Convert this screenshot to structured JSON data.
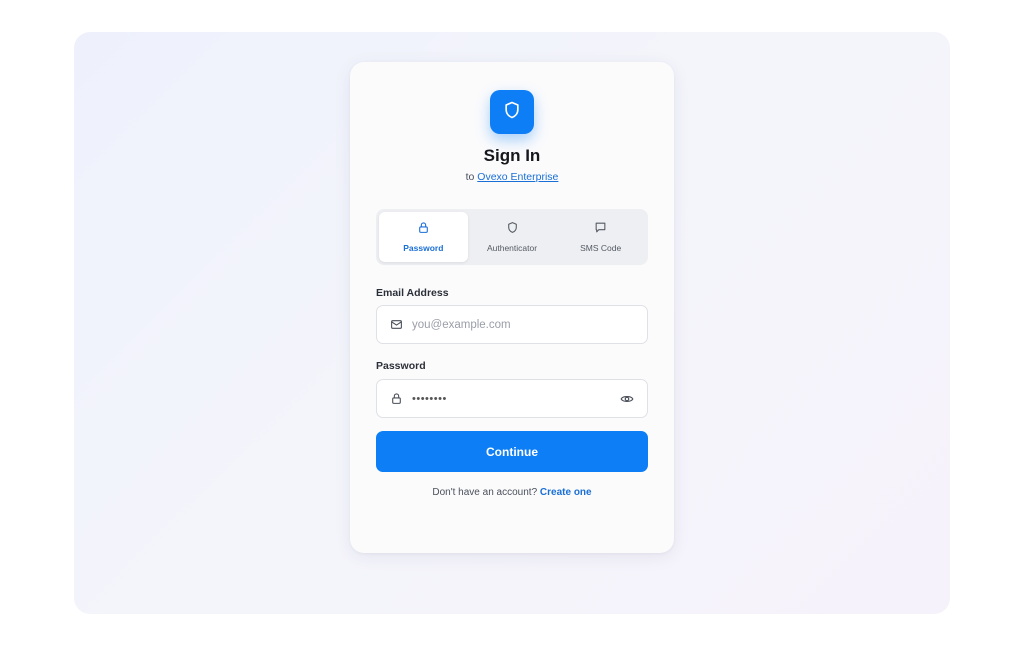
{
  "auth": {
    "title": "Sign In",
    "subtitle_prefix": "to",
    "org_name": "Ovexo Enterprise",
    "brand_color": "#0d7ef5",
    "logo_icon": "shield-icon"
  },
  "tabs": [
    {
      "label": "Password",
      "icon": "lock-icon",
      "active": true
    },
    {
      "label": "Authenticator",
      "icon": "shield-icon",
      "active": false
    },
    {
      "label": "SMS Code",
      "icon": "message-icon",
      "active": false
    }
  ],
  "email": {
    "label": "Email Address",
    "placeholder": "you@example.com",
    "value": "",
    "icon": "mail-icon"
  },
  "password": {
    "label": "Password",
    "value": "••••••••",
    "icon": "lock-icon",
    "toggle_icon": "eye-icon"
  },
  "continue_label": "Continue",
  "footer": {
    "prompt": "Don't have an account?",
    "link": "Create one"
  }
}
